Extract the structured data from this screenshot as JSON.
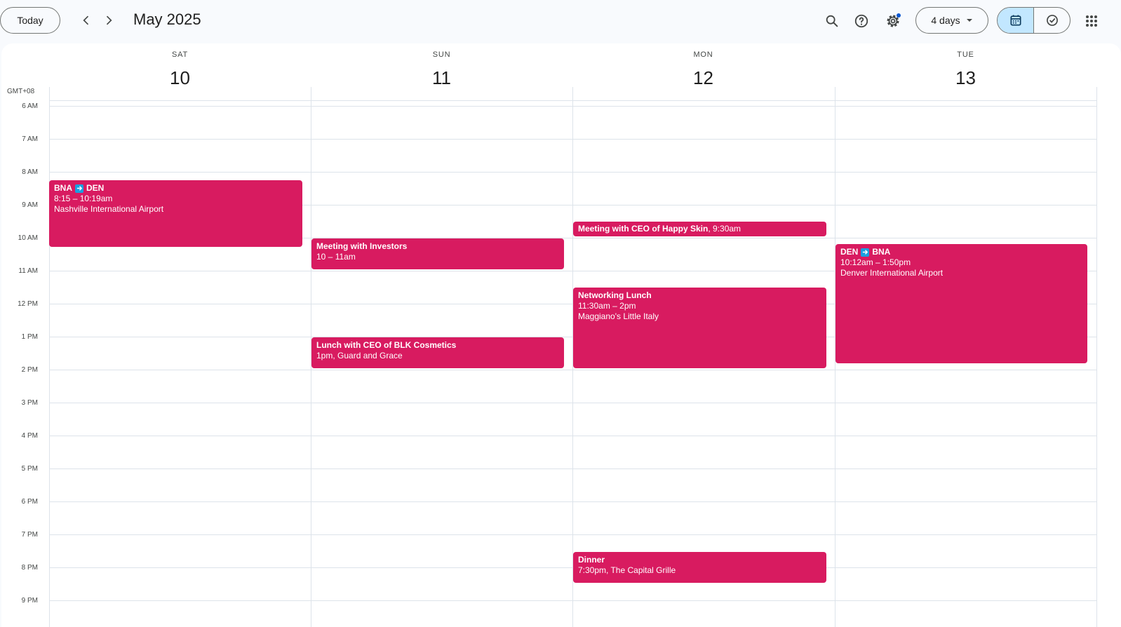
{
  "toolbar": {
    "today_label": "Today",
    "month_title": "May 2025",
    "view_label": "4 days",
    "icons": [
      "chevron-left-icon",
      "chevron-right-icon",
      "search-icon",
      "help-icon",
      "settings-icon",
      "dropdown-arrow-icon",
      "calendar-icon",
      "tasks-icon",
      "apps-grid-icon"
    ],
    "colors": {
      "accent": "#c2e7ff",
      "notification_dot": "#0b57d0"
    }
  },
  "calendar": {
    "timezone": "GMT+08",
    "days": [
      {
        "dow": "SAT",
        "date": "10"
      },
      {
        "dow": "SUN",
        "date": "11"
      },
      {
        "dow": "MON",
        "date": "12"
      },
      {
        "dow": "TUE",
        "date": "13"
      }
    ],
    "hours": [
      "6 AM",
      "7 AM",
      "8 AM",
      "9 AM",
      "10 AM",
      "11 AM",
      "12 PM",
      "1 PM",
      "2 PM",
      "3 PM",
      "4 PM",
      "5 PM",
      "6 PM",
      "7 PM",
      "8 PM",
      "9 PM"
    ],
    "event_color": "#d81b60",
    "events": {
      "flight_out": {
        "from": "BNA",
        "to": "DEN",
        "time": "8:15 – 10:19am",
        "location": "Nashville International Airport"
      },
      "investors": {
        "title": "Meeting with Investors",
        "time": "10 – 11am"
      },
      "blk_lunch": {
        "title": "Lunch with CEO of BLK Cosmetics",
        "details": "1pm, Guard and Grace"
      },
      "happy_skin": {
        "title": "Meeting with CEO of Happy Skin",
        "time": ", 9:30am"
      },
      "networking": {
        "title": "Networking Lunch",
        "time": "11:30am – 2pm",
        "location": "Maggiano's Little Italy"
      },
      "dinner": {
        "title": "Dinner",
        "details": "7:30pm, The Capital Grille"
      },
      "flight_back": {
        "from": "DEN",
        "to": "BNA",
        "time": "10:12am – 1:50pm",
        "location": "Denver International Airport"
      }
    }
  }
}
